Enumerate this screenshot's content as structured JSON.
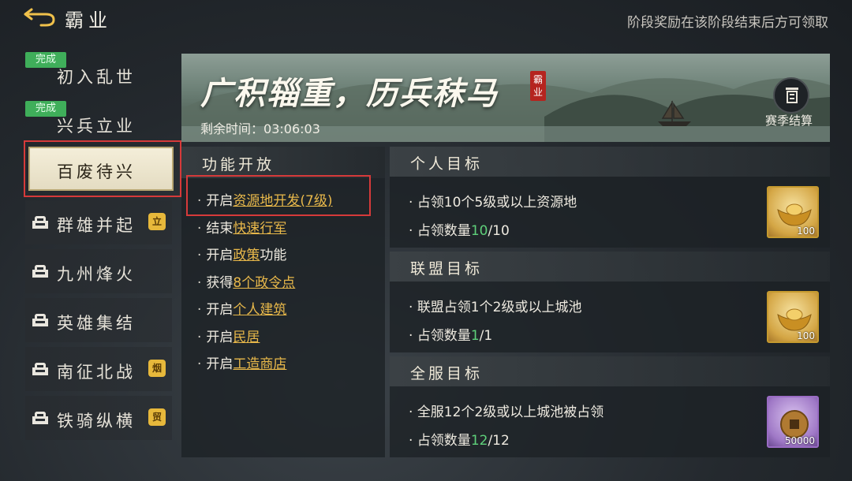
{
  "header": {
    "title": "霸业",
    "notice": "阶段奖励在该阶段结束后方可领取"
  },
  "sidebar": {
    "items": [
      {
        "label": "初入乱世",
        "badge": "完成"
      },
      {
        "label": "兴兵立业",
        "badge": "完成"
      },
      {
        "label": "百废待兴"
      },
      {
        "label": "群雄并起",
        "tag": "立"
      },
      {
        "label": "九州烽火"
      },
      {
        "label": "英雄集结"
      },
      {
        "label": "南征北战",
        "tag": "烟"
      },
      {
        "label": "铁骑纵横",
        "tag": "贸"
      }
    ]
  },
  "banner": {
    "title": "广积辎重，历兵秣马",
    "seal": "霸业",
    "countdown_label": "剩余时间：",
    "countdown": "03:06:03",
    "settle_label": "赛季结算"
  },
  "functions": {
    "title": "功能开放",
    "items": [
      {
        "prefix": "开启",
        "link": "资源地开发(7级)",
        "suffix": ""
      },
      {
        "prefix": "结束",
        "link": "快速行军",
        "suffix": ""
      },
      {
        "prefix": "开启",
        "link": "政策",
        "suffix": "功能"
      },
      {
        "prefix": "获得",
        "link": "8个政令点",
        "suffix": ""
      },
      {
        "prefix": "开启",
        "link": "个人建筑",
        "suffix": ""
      },
      {
        "prefix": "开启",
        "link": "民居",
        "suffix": ""
      },
      {
        "prefix": "开启",
        "link": "工造商店",
        "suffix": ""
      }
    ]
  },
  "goals": {
    "personal": {
      "title": "个人目标",
      "line1": "占领10个5级或以上资源地",
      "progress_label": "占领数量",
      "current": "10",
      "total": "/10",
      "reward_count": "100",
      "reward_icon": "gold-ingot-icon"
    },
    "alliance": {
      "title": "联盟目标",
      "line1": "联盟占领1个2级或以上城池",
      "progress_label": "占领数量",
      "current": "1",
      "total": "/1",
      "reward_count": "100",
      "reward_icon": "gold-ingot-icon"
    },
    "server": {
      "title": "全服目标",
      "line1": "全服12个2级或以上城池被占领",
      "progress_label": "占领数量",
      "current": "12",
      "total": "/12",
      "reward_count": "50000",
      "reward_icon": "bronze-coin-icon"
    }
  },
  "colors": {
    "highlight_red": "#d63a3a",
    "progress_green": "#5ed07a",
    "link_gold": "#e8b84a",
    "badge_green": "#3fae5a"
  }
}
